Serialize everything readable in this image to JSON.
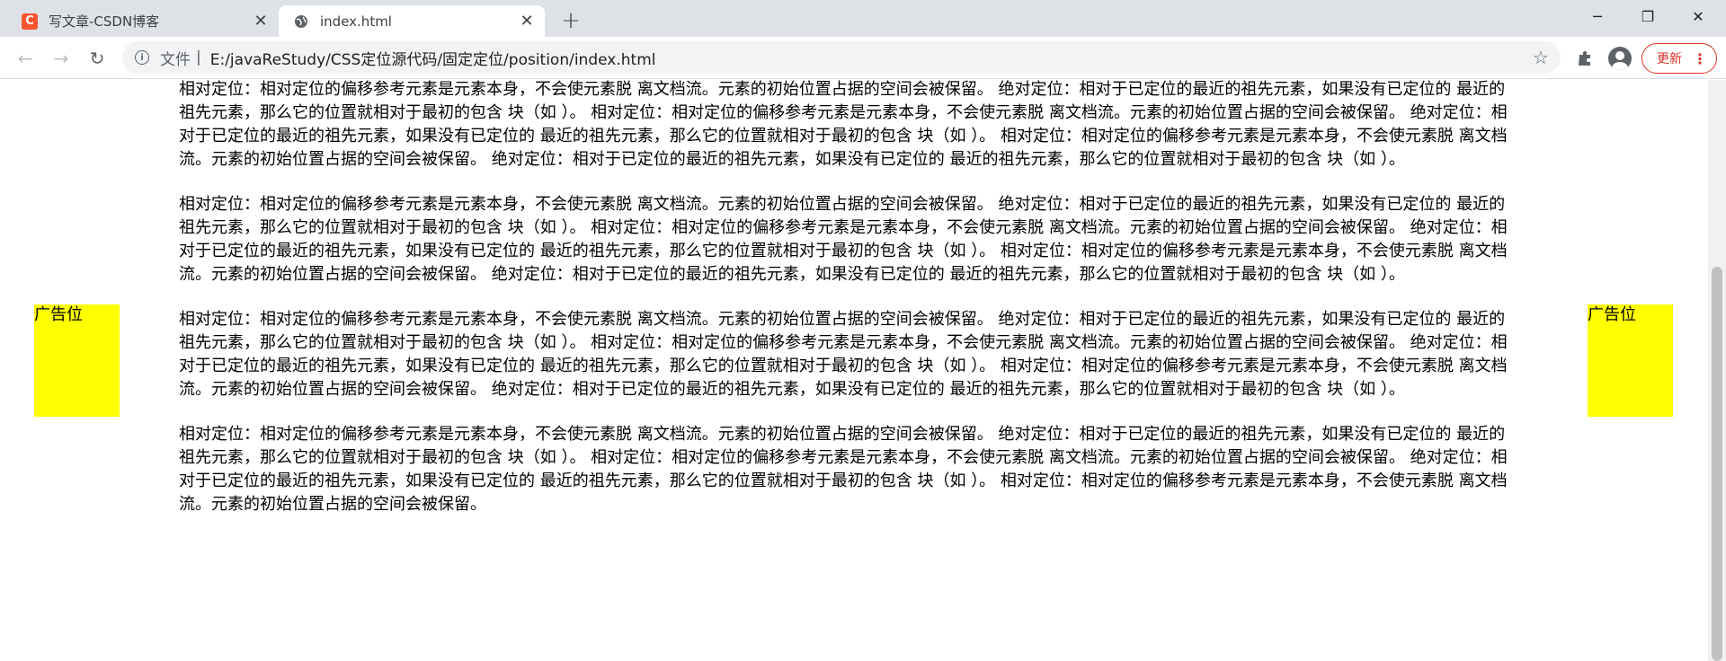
{
  "tabs": [
    {
      "title": "写文章-CSDN博客",
      "favicon": "csdn-logo-icon",
      "favicon_text": "C",
      "close": "✕"
    },
    {
      "title": "index.html",
      "favicon": "globe-icon",
      "close": "✕"
    }
  ],
  "new_tab": "+",
  "window_controls": {
    "minimize": "─",
    "maximize": "❐",
    "close": "✕"
  },
  "toolbar": {
    "back": "←",
    "forward": "→",
    "reload": "↻",
    "info_icon": "i",
    "scheme_label": "文件",
    "separator": "|",
    "url": "E:/javaReStudy/CSS定位源代码/固定定位/position/index.html",
    "star": "☆",
    "extensions": "extensions-icon",
    "update_label": "更新",
    "menu": "⋮"
  },
  "page": {
    "ad_left": "广告位",
    "ad_right": "广告位",
    "paragraphs": [
      {
        "text": "相对定位：相对定位的偏移参考元素是元素本身，不会使元素脱 离文档流。元素的初始位置占据的空间会被保留。 绝对定位：相对于已定位的最近的祖先元素，如果没有已定位的 最近的祖先元素，那么它的位置就相对于最初的包含 块（如 ）。 相对定位：相对定位的偏移参考元素是元素本身，不会使元素脱 离文档流。元素的初始位置占据的空间会被保留。 绝对定位：相对于已定位的最近的祖先元素，如果没有已定位的 最近的祖先元素，那么它的位置就相对于最初的包含 块（如 ）。 相对定位：相对定位的偏移参考元素是元素本身，不会使元素脱 离文档流。元素的初始位置占据的空间会被保留。 绝对定位：相对于已定位的最近的祖先元素，如果没有已定位的 最近的祖先元素，那么它的位置就相对于最初的包含 块（如 ）。"
      },
      {
        "text": "相对定位：相对定位的偏移参考元素是元素本身，不会使元素脱 离文档流。元素的初始位置占据的空间会被保留。 绝对定位：相对于已定位的最近的祖先元素，如果没有已定位的 最近的祖先元素，那么它的位置就相对于最初的包含 块（如 ）。 相对定位：相对定位的偏移参考元素是元素本身，不会使元素脱 离文档流。元素的初始位置占据的空间会被保留。 绝对定位：相对于已定位的最近的祖先元素，如果没有已定位的 最近的祖先元素，那么它的位置就相对于最初的包含 块（如 ）。 相对定位：相对定位的偏移参考元素是元素本身，不会使元素脱 离文档流。元素的初始位置占据的空间会被保留。 绝对定位：相对于已定位的最近的祖先元素，如果没有已定位的 最近的祖先元素，那么它的位置就相对于最初的包含 块（如 ）。"
      },
      {
        "text": "相对定位：相对定位的偏移参考元素是元素本身，不会使元素脱 离文档流。元素的初始位置占据的空间会被保留。 绝对定位：相对于已定位的最近的祖先元素，如果没有已定位的 最近的祖先元素，那么它的位置就相对于最初的包含 块（如 ）。 相对定位：相对定位的偏移参考元素是元素本身，不会使元素脱 离文档流。元素的初始位置占据的空间会被保留。 绝对定位：相对于已定位的最近的祖先元素，如果没有已定位的 最近的祖先元素，那么它的位置就相对于最初的包含 块（如 ）。 相对定位：相对定位的偏移参考元素是元素本身，不会使元素脱 离文档流。元素的初始位置占据的空间会被保留。 绝对定位：相对于已定位的最近的祖先元素，如果没有已定位的 最近的祖先元素，那么它的位置就相对于最初的包含 块（如 ）。"
      },
      {
        "text": "相对定位：相对定位的偏移参考元素是元素本身，不会使元素脱 离文档流。元素的初始位置占据的空间会被保留。 绝对定位：相对于已定位的最近的祖先元素，如果没有已定位的 最近的祖先元素，那么它的位置就相对于最初的包含 块（如 ）。 相对定位：相对定位的偏移参考元素是元素本身，不会使元素脱 离文档流。元素的初始位置占据的空间会被保留。 绝对定位：相对于已定位的最近的祖先元素，如果没有已定位的 最近的祖先元素，那么它的位置就相对于最初的包含 块（如 ）。 相对定位：相对定位的偏移参考元素是元素本身，不会使元素脱 离文档流。元素的初始位置占据的空间会被保留。"
      }
    ]
  },
  "colors": {
    "tabstrip_bg": "#dee1e6",
    "ad_bg": "#ffff00",
    "update_accent": "#d93025",
    "csdn_brand": "#fc5531"
  }
}
